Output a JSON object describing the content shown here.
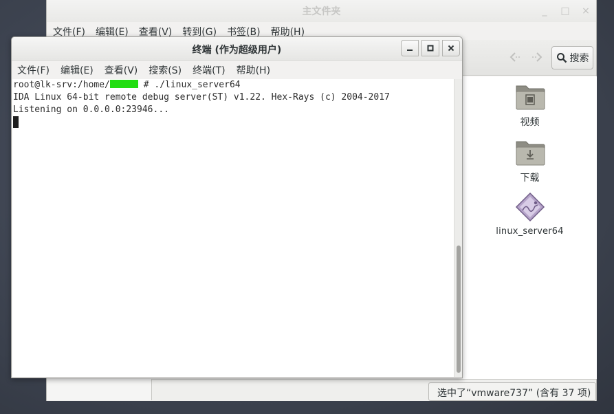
{
  "file_manager": {
    "title": "主文件夹",
    "window_buttons": {
      "minimize": "_",
      "maximize": "□",
      "close": "×"
    },
    "menu": [
      "文件(F)",
      "编辑(E)",
      "查看(V)",
      "转到(G)",
      "书签(B)",
      "帮助(H)"
    ],
    "toolbar": {
      "back_icon": "<",
      "forward_icon": ">",
      "search_label": "搜索"
    },
    "items": [
      {
        "label": "视频",
        "icon": "folder-video-icon"
      },
      {
        "label": "下载",
        "icon": "folder-download-icon"
      },
      {
        "label": "linux_server64",
        "icon": "executable-file-icon"
      }
    ],
    "status": "选中了“vmware737” (含有 37 项)"
  },
  "terminal": {
    "title": "终端 (作为超级用户)",
    "window_buttons": {
      "minimize": "_",
      "maximize": "□",
      "close": "×"
    },
    "menu": [
      "文件(F)",
      "编辑(E)",
      "查看(V)",
      "搜索(S)",
      "终端(T)",
      "帮助(H)"
    ],
    "lines": {
      "prompt_prefix": "root@lk-srv:/home/",
      "prompt_suffix": " # ./linux_server64",
      "line2": "IDA Linux 64-bit remote debug server(ST) v1.22. Hex-Rays (c) 2004-2017",
      "line3": "Listening on 0.0.0.0:23946..."
    }
  },
  "colors": {
    "desktop": "#3e4451",
    "redaction": "#22dd11",
    "window_bg": "#f2f1f0"
  }
}
